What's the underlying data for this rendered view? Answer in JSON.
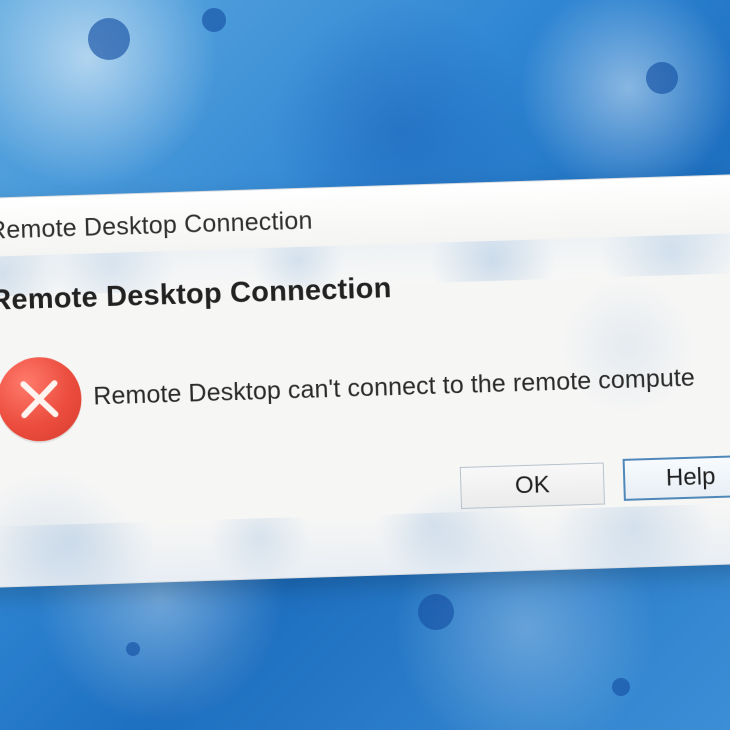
{
  "window": {
    "title": "Remote Desktop Connection"
  },
  "dialog": {
    "heading": "Remote Desktop Connection",
    "message": "Remote Desktop can't connect to the remote compute",
    "icon": "error-icon"
  },
  "buttons": {
    "ok": "OK",
    "help": "Help"
  },
  "colors": {
    "accent": "#4f88b8",
    "error": "#eb4c3d",
    "background_blue": "#2f86d3"
  }
}
